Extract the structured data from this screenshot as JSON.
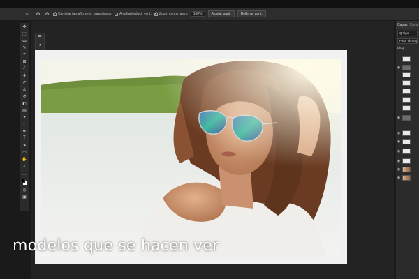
{
  "optionsbar": {
    "checkbox1_label": "Cambiar tamaño vent. para ajustar",
    "checkbox2_label": "Ampliar/reducir vent.",
    "checkbox3_label": "Zoom con arrastre",
    "zoom_value": "100%",
    "fit_button": "Ajustar pant.",
    "fill_button": "Rellenar pant."
  },
  "layers_panel": {
    "tab_active": "Capas",
    "tab_inactive": "Canal",
    "filter_label": "Q Tipo",
    "blend_mode": "Pass Through",
    "opacity_label": "Bloq:"
  },
  "subtitle": "modelos que se hacen ver",
  "colors": {
    "workspace": "#232323",
    "document_border": "#f1f1f1",
    "chrome": "#2d2d2d"
  }
}
